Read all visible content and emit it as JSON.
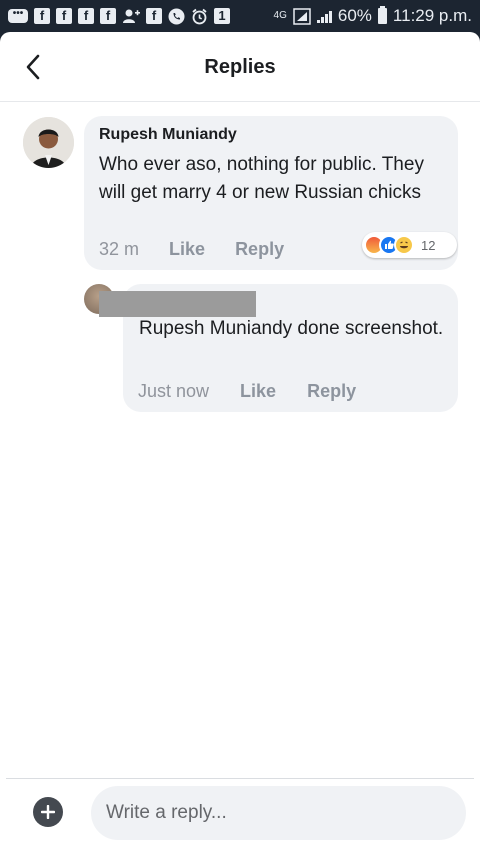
{
  "status_bar": {
    "network": "4G",
    "battery": "60%",
    "time": "11:29 p.m."
  },
  "header": {
    "title": "Replies",
    "back_icon": "chevron-left-icon"
  },
  "comment": {
    "author": "Rupesh Muniandy",
    "text": "Who ever aso, nothing for public. They will get marry 4 or new Russian chicks",
    "time": "32 m",
    "like_label": "Like",
    "reply_label": "Reply",
    "reactions": [
      "angry",
      "like",
      "haha"
    ],
    "reaction_count": "12"
  },
  "reply": {
    "text": "Rupesh Muniandy done screenshot.",
    "time": "Just now",
    "like_label": "Like",
    "reply_label": "Reply"
  },
  "composer": {
    "placeholder": "Write a reply..."
  },
  "colors": {
    "status_bar_bg": "#1c2531",
    "bubble_bg": "#f0f2f5",
    "reaction_like": "#1877f2"
  }
}
